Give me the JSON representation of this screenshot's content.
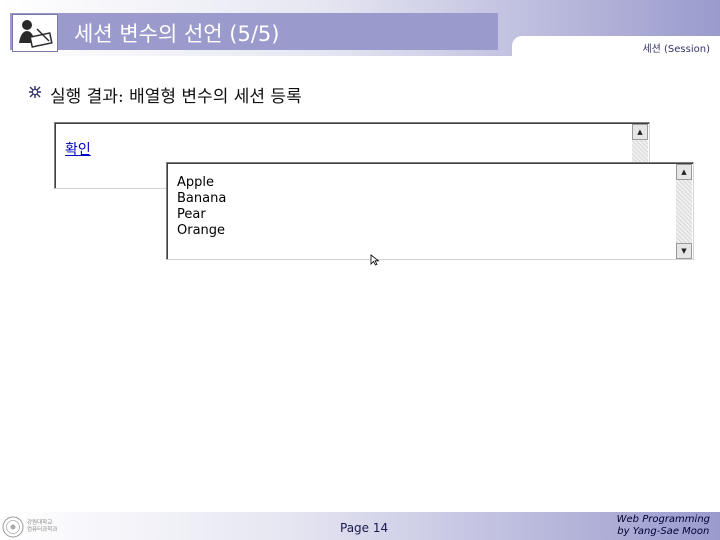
{
  "header": {
    "title_korean": "세션 변수의 선언 ",
    "title_number": "(5/5)",
    "subtitle": "세션 (Session)"
  },
  "main": {
    "bullet": "실행 결과: 배열형 변수의 세션 등록"
  },
  "browser_window_1": {
    "link_text": "확인"
  },
  "browser_window_2": {
    "items": [
      "Apple",
      "Banana",
      "Pear",
      "Orange"
    ]
  },
  "footer": {
    "logo_text_line1": "강원대학교",
    "logo_text_line2": "컴퓨터과학과",
    "page_label": "Page 14",
    "credit_line1": "Web Programming",
    "credit_line2": "by Yang-Sae Moon"
  },
  "colors": {
    "accent": "#9a9acd",
    "link": "#0000cc"
  }
}
